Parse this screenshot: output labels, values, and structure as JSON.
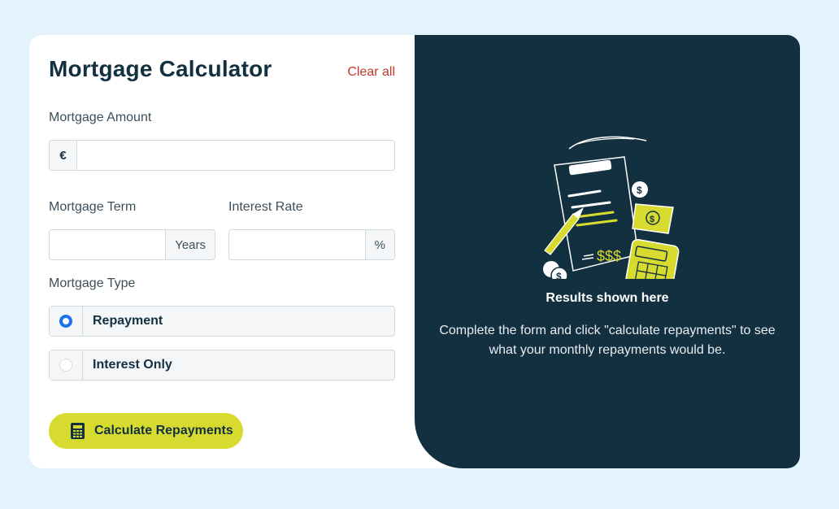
{
  "header": {
    "title": "Mortgage Calculator",
    "clear_label": "Clear all"
  },
  "amount": {
    "label": "Mortgage Amount",
    "prefix": "€",
    "value": "",
    "placeholder": ""
  },
  "term": {
    "label": "Mortgage Term",
    "suffix": "Years",
    "value": ""
  },
  "rate": {
    "label": "Interest Rate",
    "suffix": "%",
    "value": ""
  },
  "type": {
    "label": "Mortgage Type",
    "options": [
      {
        "label": "Repayment",
        "checked": true
      },
      {
        "label": "Interest Only",
        "checked": false
      }
    ]
  },
  "calculate": {
    "label": "Calculate Repayments",
    "icon": "calculator-icon"
  },
  "results": {
    "title": "Results shown here",
    "description": "Complete the form and click \"calculate repayments\" to see what your monthly repayments would be."
  },
  "colors": {
    "background": "#e3f2fb",
    "panel_dark": "#133041",
    "accent_lime": "#d8db2f",
    "clear_red": "#c0392b",
    "radio_blue": "#1a73e8"
  }
}
